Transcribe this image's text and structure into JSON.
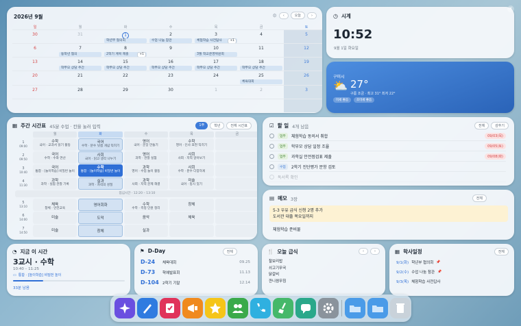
{
  "calendar": {
    "title": "2026년 9월",
    "today_btn": "오늘",
    "weekdays": [
      "일",
      "월",
      "화",
      "수",
      "목",
      "금",
      "토"
    ],
    "weeks": [
      [
        {
          "n": "30",
          "o": true
        },
        {
          "n": "31",
          "o": true
        },
        {
          "n": "1",
          "today": true,
          "ev": "학년부 협의회"
        },
        {
          "n": "2",
          "ev": "수업 나눔 참관"
        },
        {
          "n": "3",
          "ev": "체험학습 사전답사",
          "more": "+1"
        },
        {
          "n": "4"
        },
        {
          "n": "5"
        }
      ],
      [
        {
          "n": "6"
        },
        {
          "n": "7",
          "ev": "동학년 협의"
        },
        {
          "n": "8",
          "ev": "2학기 계획 제출",
          "more": "+1"
        },
        {
          "n": "9"
        },
        {
          "n": "10",
          "ev": "3월 학교운영위원회"
        },
        {
          "n": "11"
        },
        {
          "n": "12"
        }
      ],
      [
        {
          "n": "13"
        },
        {
          "n": "14",
          "ev": "학부모 상담 주간"
        },
        {
          "n": "15",
          "ev": "학부모 상담 주간"
        },
        {
          "n": "16",
          "ev": "학부모 상담 주간"
        },
        {
          "n": "17",
          "ev": "학부모 상담 주간"
        },
        {
          "n": "18",
          "ev": "학부모 상담 주간"
        },
        {
          "n": "19"
        }
      ],
      [
        {
          "n": "20"
        },
        {
          "n": "21"
        },
        {
          "n": "22"
        },
        {
          "n": "23"
        },
        {
          "n": "24"
        },
        {
          "n": "25",
          "ev": "체육대회"
        },
        {
          "n": "26"
        }
      ],
      [
        {
          "n": "27"
        },
        {
          "n": "28"
        },
        {
          "n": "29"
        },
        {
          "n": "30"
        },
        {
          "n": "1",
          "o": true
        },
        {
          "n": "2",
          "o": true
        },
        {
          "n": "3",
          "o": true
        }
      ],
      [
        {
          "n": ""
        },
        {
          "n": ""
        },
        {
          "n": ""
        },
        {
          "n": ""
        },
        {
          "n": ""
        },
        {
          "n": ""
        },
        {
          "n": ""
        }
      ]
    ]
  },
  "clock": {
    "title": "시계",
    "time": "10:52",
    "date": "9월 1일 화요일"
  },
  "weather": {
    "location": "구미시",
    "temp": "27°",
    "desc": "구름 조금 · 최고 31° 최저 22°",
    "chips": [
      "미세 좋음",
      "초미세 좋음"
    ]
  },
  "timetable": {
    "title": "주간 시간표",
    "sub": "45분 수업 · 칸을 눌러 입력",
    "btns": [
      "1주",
      "학년",
      "전체 시간표"
    ],
    "days": [
      "월",
      "화",
      "수",
      "목",
      "금"
    ],
    "rows": [
      {
        "p": "1",
        "t": "09:00",
        "cells": [
          [
            "수학",
            "국어 · 교과서 읽기 활동"
          ],
          [
            "국어",
            "수학 · 분수 덧셈 개념 익히기"
          ],
          [
            "영어",
            "국어 · 문장 만들기"
          ],
          [
            "수학",
            "영어 · 인사 표현 익히기"
          ],
          [
            "",
            ""
          ]
        ]
      },
      {
        "p": "2",
        "t": "09:50",
        "cells": [
          [
            "국어",
            "수학 · 수와 연산"
          ],
          [
            "사회",
            "국어 · 읽고 생각 나누기"
          ],
          [
            "영어",
            "과학 · 관찰 실험"
          ],
          [
            "사회",
            "사회 · 지역 알아보기"
          ],
          [
            "",
            ""
          ]
        ]
      },
      {
        "p": "3",
        "t": "10:40",
        "cells": [
          [
            "국어",
            "통합 · [놀이학습] 비밀번 놀이"
          ],
          [
            "수학",
            "통합 · [놀이학습] 비밀번 놀이"
          ],
          [
            "과학",
            "영어 · 수업 놀이 활동"
          ],
          [
            "사회",
            "수학 · 분수 다양하게"
          ],
          [
            "",
            ""
          ]
        ]
      },
      {
        "p": "4",
        "t": "11:30",
        "cells": [
          [
            "과학",
            "과학 · 실험 관찰 기록"
          ],
          [
            "실과",
            "과학 · 자석의 성질"
          ],
          [
            "과학",
            "사회 · 지역 문제 해결"
          ],
          [
            "미술",
            "국어 · 동시 짓기"
          ],
          [
            "",
            ""
          ]
        ]
      }
    ],
    "lunch": "점심시간 · 12:20 – 13:10",
    "rows2": [
      {
        "p": "5",
        "t": "13:10",
        "cells": [
          [
            "체육",
            "창체 · 안전교육"
          ],
          [
            "영어회화",
            ""
          ],
          [
            "수학",
            "수학 · 측정 단원 정리"
          ],
          [
            "창체",
            ""
          ],
          [
            "",
            ""
          ]
        ]
      },
      {
        "p": "6",
        "t": "14:00",
        "cells": [
          [
            "미술",
            ""
          ],
          [
            "도덕",
            ""
          ],
          [
            "음악",
            ""
          ],
          [
            "체육",
            ""
          ],
          [
            "",
            ""
          ]
        ]
      },
      {
        "p": "7",
        "t": "14:50",
        "cells": [
          [
            "미술",
            ""
          ],
          [
            "창체",
            ""
          ],
          [
            "실과",
            ""
          ],
          [
            "",
            ""
          ],
          [
            "",
            ""
          ]
        ]
      }
    ]
  },
  "todo": {
    "title": "할 일",
    "count": "4개 남음",
    "btns": [
      "전체",
      "감추기"
    ],
    "items": [
      {
        "tag": "업무",
        "text": "체험학습 동의서 취합",
        "due": "09/03(목)"
      },
      {
        "tag": "업무",
        "text": "학부모 상담 일정 조율",
        "due": "09/05(토)"
      },
      {
        "tag": "업무",
        "text": "과학실 안전점검표 제출",
        "due": "09/08(화)"
      },
      {
        "tag": "수업",
        "text": "2학기 진단평가 문항 검토",
        "due": ""
      },
      {
        "tag": "",
        "text": "독서록 확인",
        "due": ""
      }
    ]
  },
  "memo": {
    "title": "메모",
    "count": "3장",
    "btn": "전체",
    "lines": [
      "5-3 우유 급식 신청 2명 추가",
      "도서관 대출 목요일까지"
    ],
    "note2": "체험학습 준비물"
  },
  "current": {
    "title": "지금 이 시간",
    "period": "3교시 · 수학",
    "time": "10:40 – 11:25",
    "detail": "통합 · [놀이학습] 비밀번 놀이",
    "remain": "33분 남음",
    "progress": 0.27
  },
  "dday": {
    "title": "D-Day",
    "btn": "전체",
    "items": [
      {
        "d": "D-24",
        "name": "체육대회",
        "date": "09.25"
      },
      {
        "d": "D-73",
        "name": "학예발표회",
        "date": "11.13"
      },
      {
        "d": "D-104",
        "name": "2학기 기말",
        "date": "12.14"
      }
    ]
  },
  "meal": {
    "title": "오늘 급식",
    "items": [
      "찰보리밥",
      "쇠고기무국",
      "닭갈비",
      "깐니쌈무침"
    ]
  },
  "schedule": {
    "title": "학사일정",
    "btn": "전체",
    "items": [
      {
        "d": "9/1(화)",
        "name": "학년부 협의회",
        "pin": true
      },
      {
        "d": "9/2(수)",
        "name": "수업 나눔 참관",
        "pin": true
      },
      {
        "d": "9/3(목)",
        "name": "체험학습 사전답사",
        "pin": false
      }
    ]
  },
  "dock": {
    "apps": [
      "ai-sparkle-icon",
      "pen-icon",
      "checklist-icon",
      "megaphone-icon",
      "star-icon",
      "people-icon",
      "phone-icon",
      "broom-icon",
      "chat-icon",
      "gear-icon",
      "folder-icon",
      "folder-icon-2",
      "trash-icon"
    ]
  },
  "colors": {
    "accent": "#2f6fd6",
    "weather_bg": "#2c6fc9",
    "sunday": "#d64545",
    "due_red": "#d64545"
  }
}
